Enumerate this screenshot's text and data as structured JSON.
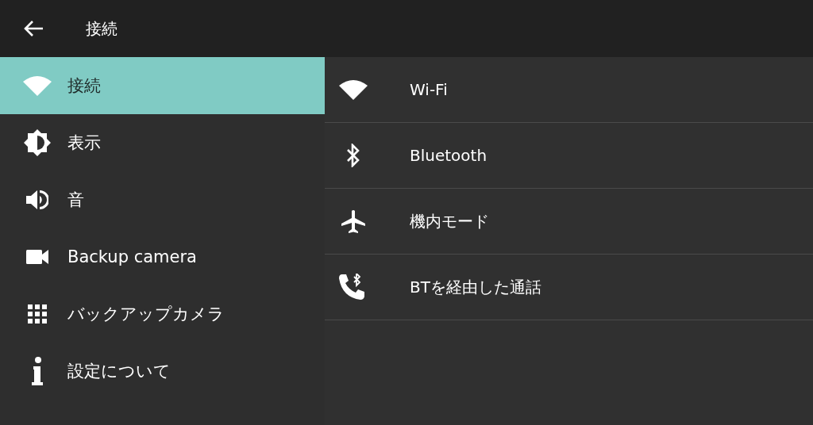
{
  "header": {
    "title": "接続"
  },
  "sidebar": {
    "items": [
      {
        "kind": "wifi",
        "label": "接続",
        "selected": true
      },
      {
        "kind": "brightness",
        "label": "表示",
        "selected": false
      },
      {
        "kind": "volume",
        "label": "音",
        "selected": false
      },
      {
        "kind": "camera",
        "label": "Backup camera",
        "selected": false
      },
      {
        "kind": "grid",
        "label": "バックアップカメラ",
        "selected": false
      },
      {
        "kind": "info",
        "label": "設定について",
        "selected": false
      }
    ]
  },
  "settings": [
    {
      "kind": "wifi",
      "label": "Wi-Fi"
    },
    {
      "kind": "bluetooth",
      "label": "Bluetooth"
    },
    {
      "kind": "airplane",
      "label": "機内モード"
    },
    {
      "kind": "bt-phone",
      "label": "BTを経由した通話"
    }
  ]
}
